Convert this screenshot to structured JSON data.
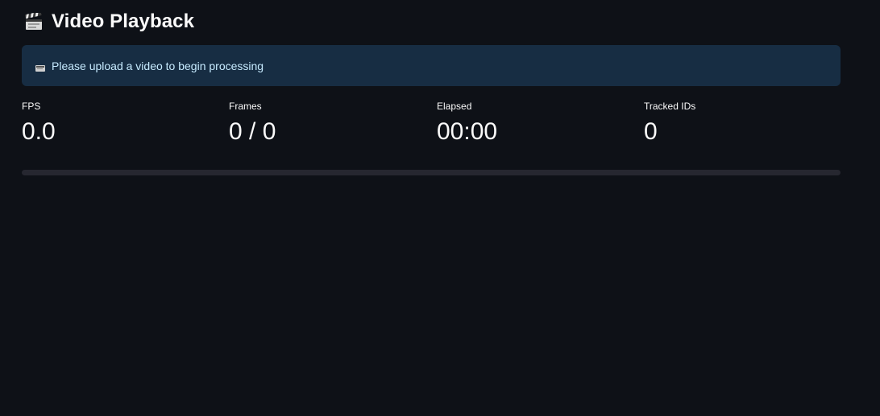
{
  "header": {
    "icon": "clapperboard-icon",
    "title": "Video Playback"
  },
  "info": {
    "icon": "video-icon",
    "message": "Please upload a video to begin processing"
  },
  "metrics": [
    {
      "label": "FPS",
      "value": "0.0"
    },
    {
      "label": "Frames",
      "value": "0 / 0"
    },
    {
      "label": "Elapsed",
      "value": "00:00"
    },
    {
      "label": "Tracked IDs",
      "value": "0"
    }
  ],
  "progress": {
    "fraction": 0
  },
  "colors": {
    "background": "#0e1117",
    "info_background": "#172d43",
    "info_text": "#c7ebff",
    "progress_track": "#262730"
  }
}
